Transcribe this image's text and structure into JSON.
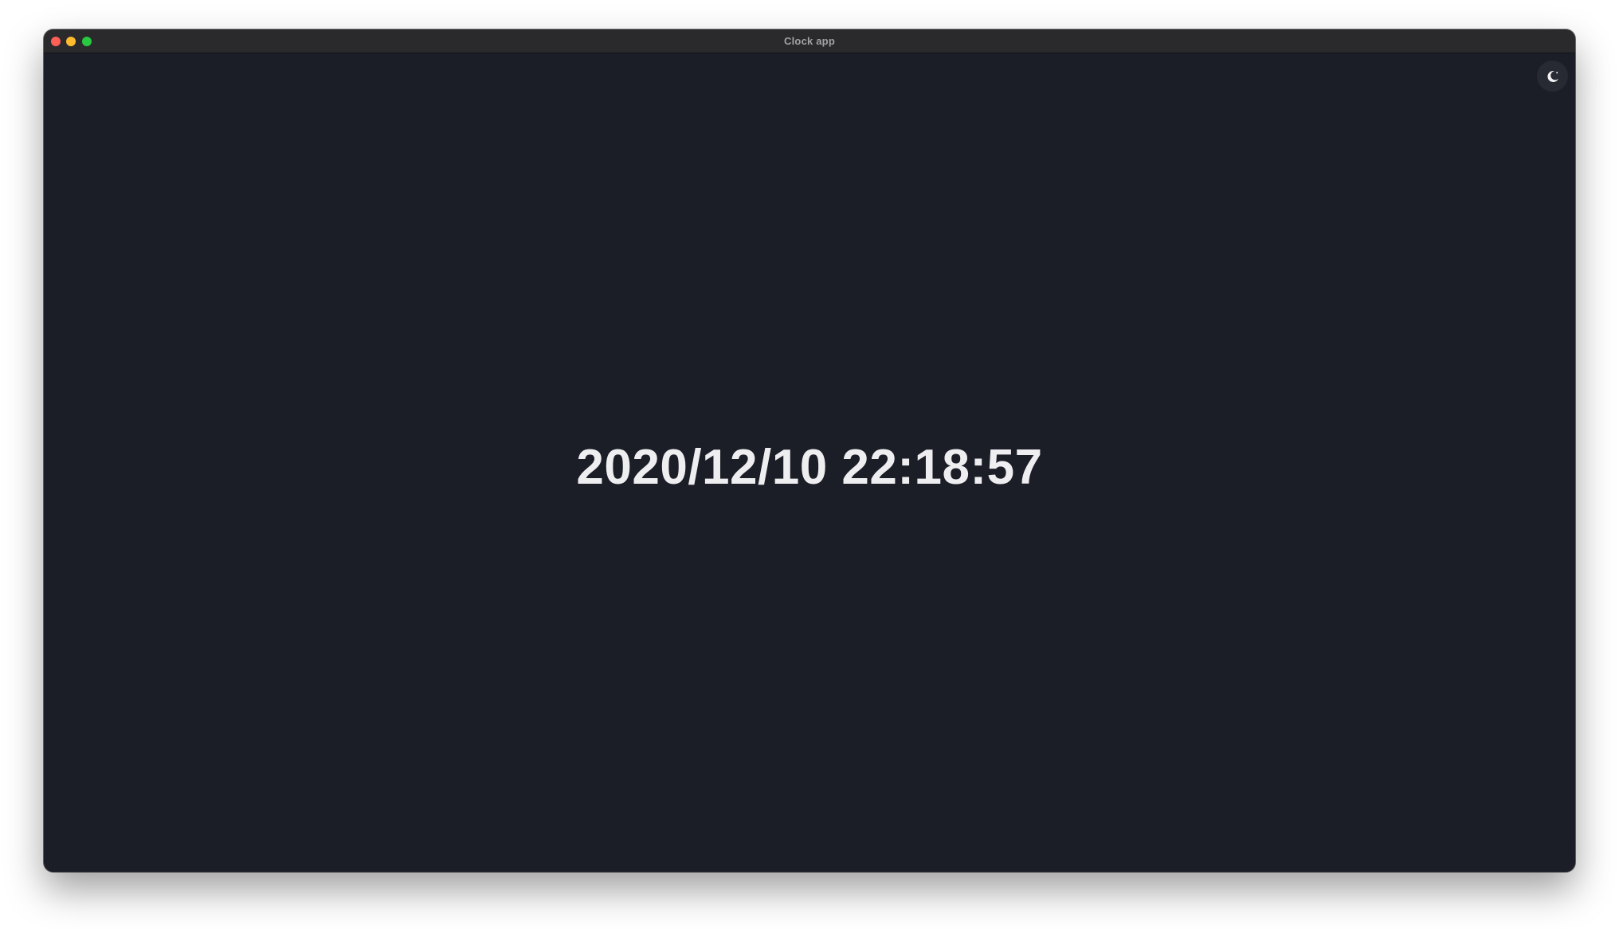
{
  "window": {
    "title": "Clock app"
  },
  "toolbar": {
    "theme_toggle_icon": "moon-icon"
  },
  "clock": {
    "datetime": "2020/12/10 22:18:57"
  },
  "colors": {
    "background": "#1b1e27",
    "text": "#eeeef0",
    "titlebar": "#2a2a2c"
  }
}
